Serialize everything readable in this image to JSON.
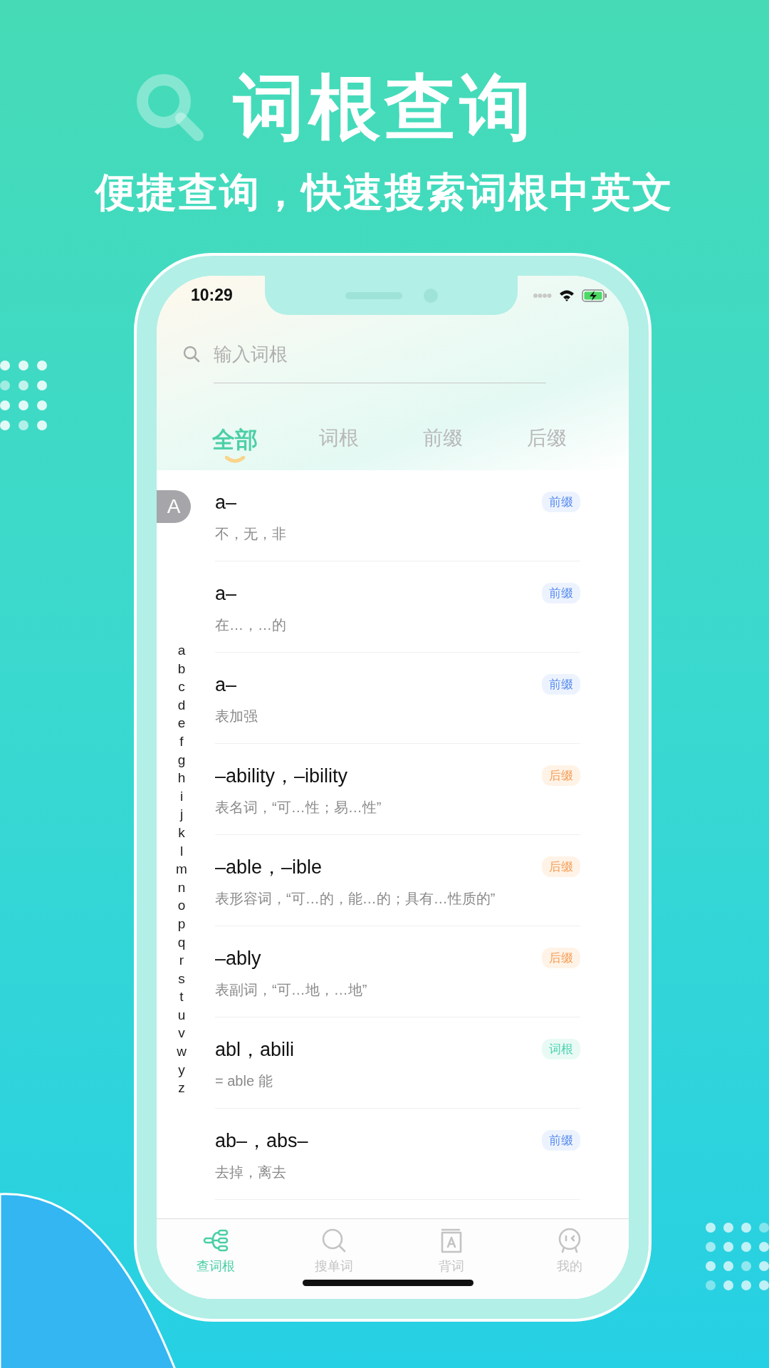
{
  "header": {
    "title": "词根查询",
    "subtitle": "便捷查询，快速搜索词根中英文"
  },
  "status_bar": {
    "time": "10:29"
  },
  "search": {
    "placeholder": "输入词根"
  },
  "tabs": [
    {
      "label": "全部",
      "selected": true
    },
    {
      "label": "词根",
      "selected": false
    },
    {
      "label": "前缀",
      "selected": false
    },
    {
      "label": "后缀",
      "selected": false
    }
  ],
  "section_letter": "A",
  "entries": [
    {
      "term": "a–",
      "meaning": "不，无，非",
      "tag": {
        "label": "前缀",
        "kind": "prefix"
      }
    },
    {
      "term": "a–",
      "meaning": "在…，…的",
      "tag": {
        "label": "前缀",
        "kind": "prefix"
      }
    },
    {
      "term": "a–",
      "meaning": "表加强",
      "tag": {
        "label": "前缀",
        "kind": "prefix"
      }
    },
    {
      "term": "–ability，–ibility",
      "meaning": "表名词，“可…性；易…性”",
      "tag": {
        "label": "后缀",
        "kind": "suffix"
      }
    },
    {
      "term": "–able，–ible",
      "meaning": "表形容词，“可…的，能…的；具有…性质的”",
      "tag": {
        "label": "后缀",
        "kind": "suffix"
      }
    },
    {
      "term": "–ably",
      "meaning": "表副词，“可…地，…地”",
      "tag": {
        "label": "后缀",
        "kind": "suffix"
      }
    },
    {
      "term": "abl，abili",
      "meaning": "= able 能",
      "tag": {
        "label": "词根",
        "kind": "root"
      }
    },
    {
      "term": "ab–，abs–",
      "meaning": "去掉，离去",
      "tag": {
        "label": "前缀",
        "kind": "prefix"
      }
    }
  ],
  "index_letters": [
    "a",
    "b",
    "c",
    "d",
    "e",
    "f",
    "g",
    "h",
    "i",
    "j",
    "k",
    "l",
    "m",
    "n",
    "o",
    "p",
    "q",
    "r",
    "s",
    "t",
    "u",
    "v",
    "w",
    "y",
    "z"
  ],
  "bottom_nav": [
    {
      "label": "查词根",
      "selected": true
    },
    {
      "label": "搜单词",
      "selected": false
    },
    {
      "label": "背词",
      "selected": false
    },
    {
      "label": "我的",
      "selected": false
    }
  ]
}
